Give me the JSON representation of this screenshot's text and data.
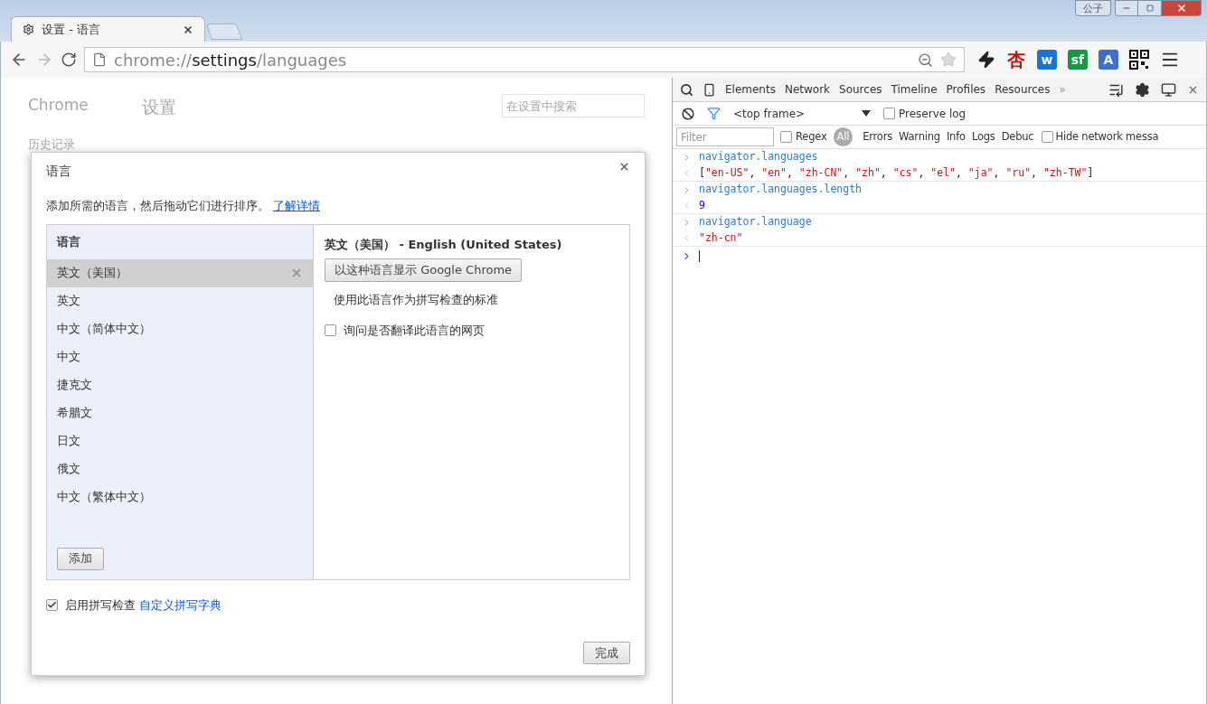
{
  "window": {
    "user_badge": "公子"
  },
  "tab": {
    "title": "设置 - 语言",
    "selected": true
  },
  "address_bar": {
    "prefix": "chrome://",
    "host": "settings",
    "path": "/languages"
  },
  "extensions": [
    {
      "kind": "icon"
    },
    {
      "kind": "text",
      "label": "杏",
      "color": "#cc1111"
    },
    {
      "kind": "tile",
      "label": "w",
      "color": "#1a73d9"
    },
    {
      "kind": "tile",
      "label": "sf",
      "color": "#119944"
    },
    {
      "kind": "tile",
      "label": "A",
      "color": "#3b6fd0"
    },
    {
      "kind": "qr"
    }
  ],
  "settings_page": {
    "brand": "Chrome",
    "title": "设置",
    "search_placeholder": "在设置中搜索",
    "nav_items": [
      "历史记录"
    ]
  },
  "dialog": {
    "title": "语言",
    "description": "添加所需的语言，然后拖动它们进行排序。",
    "learn_more": "了解详情",
    "list_header": "语言",
    "languages": [
      {
        "name": "英文（美国）",
        "selected": true
      },
      {
        "name": "英文",
        "selected": false
      },
      {
        "name": "中文（简体中文）",
        "selected": false
      },
      {
        "name": "中文",
        "selected": false
      },
      {
        "name": "捷克文",
        "selected": false
      },
      {
        "name": "希腊文",
        "selected": false
      },
      {
        "name": "日文",
        "selected": false
      },
      {
        "name": "俄文",
        "selected": false
      },
      {
        "name": "中文（繁体中文）",
        "selected": false
      }
    ],
    "add_button": "添加",
    "detail_title": "英文（美国） - English (United States)",
    "display_button": "以这种语言显示 Google Chrome",
    "spellcheck_note": "使用此语言作为拼写检查的标准",
    "translate_option": {
      "label": "询问是否翻译此语言的网页",
      "checked": false
    },
    "spellcheck": {
      "label": "启用拼写检查",
      "checked": true
    },
    "custom_dictionary": "自定义拼写字典",
    "done_button": "完成"
  },
  "devtools": {
    "tabs": [
      {
        "label": "Elements",
        "selected": false
      },
      {
        "label": "Network",
        "selected": false
      },
      {
        "label": "Sources",
        "selected": false
      },
      {
        "label": "Timeline",
        "selected": false
      },
      {
        "label": "Profiles",
        "selected": false
      },
      {
        "label": "Resources",
        "selected": false
      }
    ],
    "overflow": "»",
    "frame": "<top frame>",
    "preserve_log": {
      "label": "Preserve log",
      "checked": false
    },
    "filter_placeholder": "Filter",
    "regex": {
      "label": "Regex",
      "checked": false
    },
    "levels": [
      {
        "label": "All",
        "selected": true
      },
      {
        "label": "Errors",
        "selected": false
      },
      {
        "label": "Warning",
        "selected": false
      },
      {
        "label": "Info",
        "selected": false
      },
      {
        "label": "Logs",
        "selected": false
      },
      {
        "label": "Debuc",
        "selected": false
      }
    ],
    "hide_network": {
      "label": "Hide network messa",
      "checked": false
    },
    "console": [
      {
        "kind": "input",
        "text": "navigator.languages"
      },
      {
        "kind": "output",
        "parts": [
          {
            "kind": "punct",
            "text": "["
          },
          {
            "kind": "string",
            "text": "\"en-US\""
          },
          {
            "kind": "punct",
            "text": ", "
          },
          {
            "kind": "string",
            "text": "\"en\""
          },
          {
            "kind": "punct",
            "text": ", "
          },
          {
            "kind": "string",
            "text": "\"zh-CN\""
          },
          {
            "kind": "punct",
            "text": ", "
          },
          {
            "kind": "string",
            "text": "\"zh\""
          },
          {
            "kind": "punct",
            "text": ", "
          },
          {
            "kind": "string",
            "text": "\"cs\""
          },
          {
            "kind": "punct",
            "text": ", "
          },
          {
            "kind": "string",
            "text": "\"el\""
          },
          {
            "kind": "punct",
            "text": ", "
          },
          {
            "kind": "string",
            "text": "\"ja\""
          },
          {
            "kind": "punct",
            "text": ", "
          },
          {
            "kind": "string",
            "text": "\"ru\""
          },
          {
            "kind": "punct",
            "text": ", "
          },
          {
            "kind": "string",
            "text": "\"zh-TW\""
          },
          {
            "kind": "punct",
            "text": "]"
          }
        ]
      },
      {
        "kind": "input",
        "text": "navigator.languages.length"
      },
      {
        "kind": "output",
        "parts": [
          {
            "kind": "number",
            "text": "9"
          }
        ]
      },
      {
        "kind": "input",
        "text": "navigator.language"
      },
      {
        "kind": "output",
        "parts": [
          {
            "kind": "string",
            "text": "\"zh-cn\""
          }
        ]
      }
    ]
  }
}
